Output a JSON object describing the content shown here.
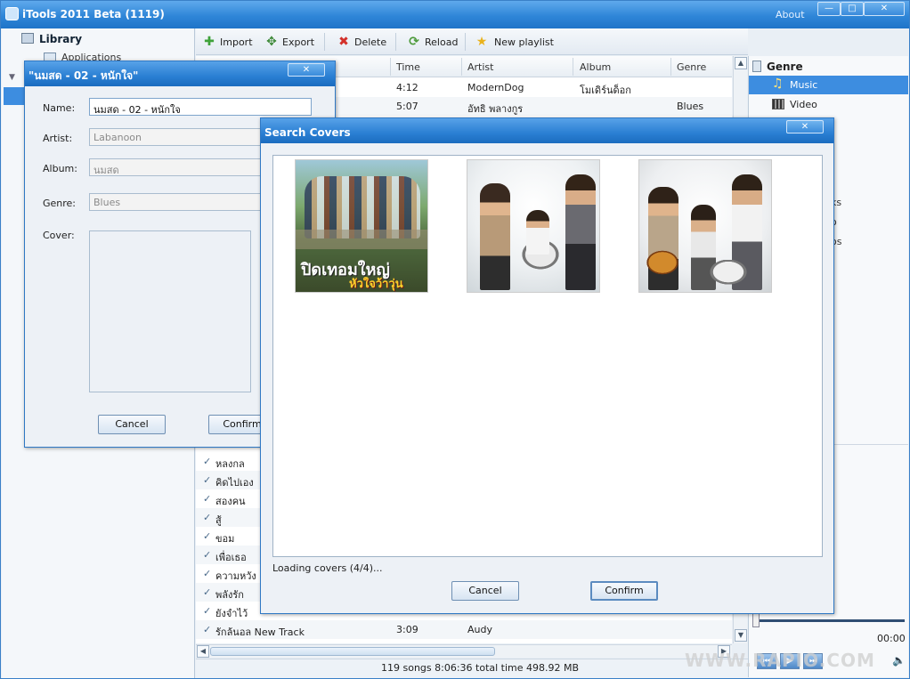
{
  "window": {
    "title": "iTools 2011 Beta (1119)",
    "about": "About"
  },
  "left": {
    "header": "Library",
    "item": "Applications"
  },
  "toolbar": {
    "import": "Import",
    "export": "Export",
    "delete": "Delete",
    "reload": "Reload",
    "new_playlist": "New playlist"
  },
  "list": {
    "columns": {
      "time": "Time",
      "artist": "Artist",
      "album": "Album",
      "genre": "Genre"
    },
    "top_rows": [
      {
        "time": "4:12",
        "artist": "ModernDog",
        "album": "โมเดิร์นด็อก",
        "genre": ""
      },
      {
        "time": "5:07",
        "artist": "อัทธิ พลางกูร",
        "album": "",
        "genre": "Blues"
      }
    ],
    "bottom_rows": [
      {
        "name": "หลงกล"
      },
      {
        "name": "คิดไปเอง"
      },
      {
        "name": "สองคน"
      },
      {
        "name": "สู้"
      },
      {
        "name": "ขอม"
      },
      {
        "name": "เพื่อเธอ"
      },
      {
        "name": "ความหวัง"
      },
      {
        "name": "พลังรัก"
      },
      {
        "name": "ยังจำไว้"
      },
      {
        "name": "รักล้นอล New Track",
        "time": "3:09",
        "artist": "Audy"
      }
    ],
    "status": "119  songs  8:06:36 total time  498.92 MB"
  },
  "genre": {
    "header": "Genre",
    "music": "Music",
    "video": "Video",
    "frag1": "ks",
    "frag2": "o",
    "frag3": "os"
  },
  "player": {
    "time": "00:00"
  },
  "edit_dialog": {
    "title": "\"นมสด - 02 - หนักใจ\"",
    "name_label": "Name:",
    "name_value": "นมสด - 02 - หนักใจ",
    "artist_label": "Artist:",
    "artist_value": "Labanoon",
    "album_label": "Album:",
    "album_value": "นมสด",
    "genre_label": "Genre:",
    "genre_value": "Blues",
    "cover_label": "Cover:",
    "cancel": "Cancel",
    "confirm": "Confirm"
  },
  "search_dialog": {
    "title": "Search Covers",
    "cover1_text_line1": "ปิดเทอมใหญ่",
    "cover1_text_line2": "หัวใจว้าวุ่น",
    "status": "Loading covers (4/4)...",
    "cancel": "Cancel",
    "confirm": "Confirm"
  },
  "watermark": "WWW.RAPIO.COM",
  "colors": {
    "accent": "#2f86d8",
    "selection": "#3d8de0"
  }
}
